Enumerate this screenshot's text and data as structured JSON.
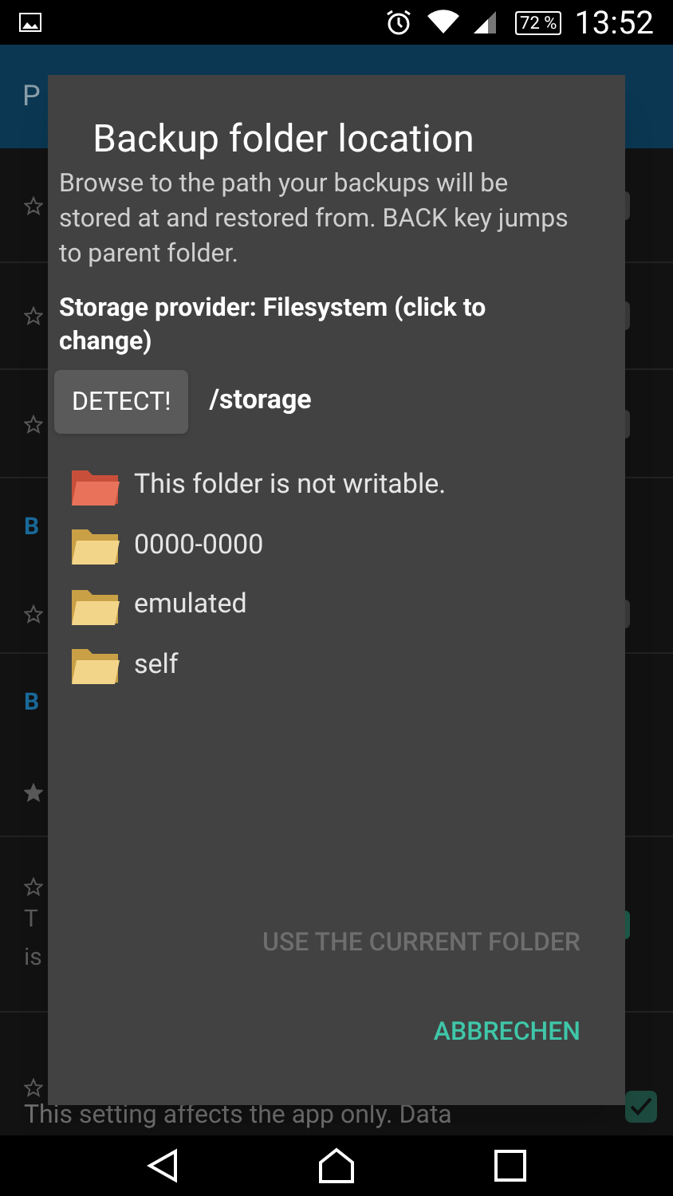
{
  "status_bar": {
    "battery": "72 %",
    "time": "13:52"
  },
  "background": {
    "toolbar_title": "P",
    "rows": [
      {
        "kind": "setting",
        "starred": false,
        "control": {
          "kind": "switch",
          "on": false
        }
      },
      {
        "kind": "setting",
        "starred": false,
        "control": {
          "kind": "switch",
          "on": false
        }
      },
      {
        "kind": "setting",
        "starred": false,
        "control": {
          "kind": "switch",
          "on": false
        }
      },
      {
        "kind": "header",
        "text": "B"
      },
      {
        "kind": "setting",
        "starred": false,
        "control": {
          "kind": "switch",
          "on": false
        }
      },
      {
        "kind": "header",
        "text": "B"
      },
      {
        "kind": "setting",
        "starred": true
      },
      {
        "kind": "setting",
        "starred": false,
        "lines": [
          "T",
          "is"
        ],
        "control": {
          "kind": "switch",
          "on": true
        }
      },
      {
        "kind": "setting",
        "starred": false,
        "lines": [
          "This setting affects the app only. Data"
        ],
        "control": {
          "kind": "checkbox",
          "on": true
        }
      }
    ]
  },
  "dialog": {
    "title": "Backup folder location",
    "description": "Browse to the path your backups will be stored at and restored from. BACK key jumps to parent folder.",
    "provider": "Storage provider: Filesystem (click to change)",
    "detect_button": "DETECT!",
    "path": "/storage",
    "entries": [
      {
        "kind": "error",
        "label": "This folder is not writable."
      },
      {
        "kind": "folder",
        "label": "0000-0000"
      },
      {
        "kind": "folder",
        "label": "emulated"
      },
      {
        "kind": "folder",
        "label": "self"
      }
    ],
    "buttons": [
      {
        "label": "USE THE CURRENT FOLDER",
        "disabled": true
      },
      {
        "label": "ABBRECHEN",
        "disabled": false
      }
    ]
  }
}
